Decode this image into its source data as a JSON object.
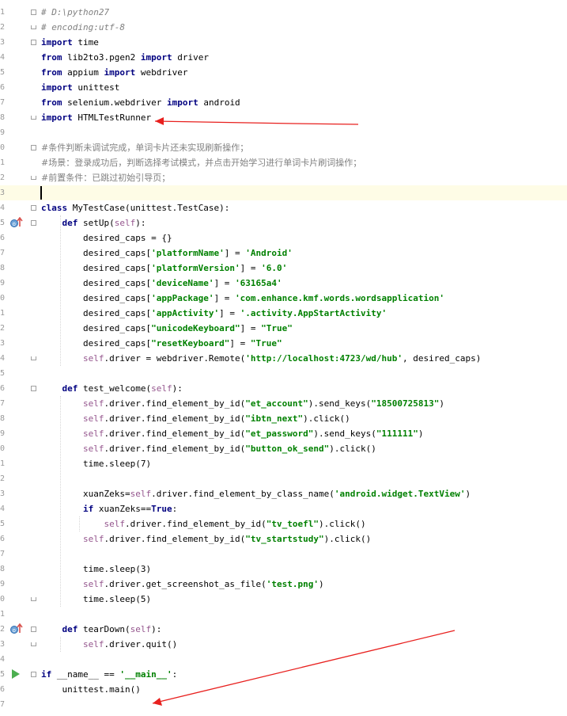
{
  "editor": {
    "line_numbers": [
      "1",
      "2",
      "3",
      "4",
      "5",
      "6",
      "7",
      "8",
      "9",
      "0",
      "1",
      "2",
      "3",
      "4",
      "5",
      "6",
      "7",
      "8",
      "9",
      "0",
      "1",
      "2",
      "3",
      "4",
      "5",
      "6",
      "7",
      "8",
      "9",
      "0",
      "1",
      "2",
      "3",
      "4",
      "5",
      "6",
      "7",
      "8",
      "9",
      "0",
      "1",
      "2",
      "3",
      "4",
      "5",
      "6",
      "7"
    ],
    "current_line": 13,
    "lines": [
      [
        {
          "c": "cmt",
          "t": "# D:\\python27"
        }
      ],
      [
        {
          "c": "cmt",
          "t": "# encoding:utf-8"
        }
      ],
      [
        {
          "c": "kw",
          "t": "import"
        },
        {
          "c": "",
          "t": " time"
        }
      ],
      [
        {
          "c": "kw",
          "t": "from"
        },
        {
          "c": "",
          "t": " lib2to3.pgen2 "
        },
        {
          "c": "kw",
          "t": "import"
        },
        {
          "c": "",
          "t": " driver"
        }
      ],
      [
        {
          "c": "kw",
          "t": "from"
        },
        {
          "c": "",
          "t": " appium "
        },
        {
          "c": "kw",
          "t": "import"
        },
        {
          "c": "",
          "t": " webdriver"
        }
      ],
      [
        {
          "c": "kw",
          "t": "import"
        },
        {
          "c": "",
          "t": " unittest"
        }
      ],
      [
        {
          "c": "kw",
          "t": "from"
        },
        {
          "c": "",
          "t": " selenium.webdriver "
        },
        {
          "c": "kw",
          "t": "import"
        },
        {
          "c": "",
          "t": " android"
        }
      ],
      [
        {
          "c": "kw",
          "t": "import"
        },
        {
          "c": "",
          "t": " HTMLTestRunner"
        }
      ],
      [],
      [
        {
          "c": "zh",
          "t": "#条件判断未调试完成，单词卡片还未实现刷新操作；"
        }
      ],
      [
        {
          "c": "zh",
          "t": "#场景：登录成功后，判断选择考试模式，并点击开始学习进行单词卡片刷词操作；"
        }
      ],
      [
        {
          "c": "zh",
          "t": "#前置条件：已跳过初始引导页；"
        }
      ],
      [],
      [
        {
          "c": "kw",
          "t": "class"
        },
        {
          "c": "",
          "t": " MyTestCase(unittest.TestCase):"
        }
      ],
      [
        {
          "c": "",
          "t": "    "
        },
        {
          "c": "kw",
          "t": "def"
        },
        {
          "c": "",
          "t": " setUp("
        },
        {
          "c": "slf",
          "t": "self"
        },
        {
          "c": "",
          "t": "):"
        }
      ],
      [
        {
          "c": "",
          "t": "        desired_caps = {}"
        }
      ],
      [
        {
          "c": "",
          "t": "        desired_caps["
        },
        {
          "c": "str",
          "t": "'platformName'"
        },
        {
          "c": "",
          "t": "] = "
        },
        {
          "c": "str",
          "t": "'Android'"
        }
      ],
      [
        {
          "c": "",
          "t": "        desired_caps["
        },
        {
          "c": "str",
          "t": "'platformVersion'"
        },
        {
          "c": "",
          "t": "] = "
        },
        {
          "c": "str",
          "t": "'6.0'"
        }
      ],
      [
        {
          "c": "",
          "t": "        desired_caps["
        },
        {
          "c": "str",
          "t": "'deviceName'"
        },
        {
          "c": "",
          "t": "] = "
        },
        {
          "c": "str",
          "t": "'63165a4'"
        }
      ],
      [
        {
          "c": "",
          "t": "        desired_caps["
        },
        {
          "c": "str",
          "t": "'appPackage'"
        },
        {
          "c": "",
          "t": "] = "
        },
        {
          "c": "str",
          "t": "'com.enhance.kmf.words.wordsapplication'"
        }
      ],
      [
        {
          "c": "",
          "t": "        desired_caps["
        },
        {
          "c": "str",
          "t": "'appActivity'"
        },
        {
          "c": "",
          "t": "] = "
        },
        {
          "c": "str",
          "t": "'.activity.AppStartActivity'"
        }
      ],
      [
        {
          "c": "",
          "t": "        desired_caps["
        },
        {
          "c": "str",
          "t": "\"unicodeKeyboard\""
        },
        {
          "c": "",
          "t": "] = "
        },
        {
          "c": "str",
          "t": "\"True\""
        }
      ],
      [
        {
          "c": "",
          "t": "        desired_caps["
        },
        {
          "c": "str",
          "t": "\"resetKeyboard\""
        },
        {
          "c": "",
          "t": "] = "
        },
        {
          "c": "str",
          "t": "\"True\""
        }
      ],
      [
        {
          "c": "",
          "t": "        "
        },
        {
          "c": "slf",
          "t": "self"
        },
        {
          "c": "",
          "t": ".driver = webdriver.Remote("
        },
        {
          "c": "str",
          "t": "'http://localhost:4723/wd/hub'"
        },
        {
          "c": "",
          "t": ", desired_caps)"
        }
      ],
      [],
      [
        {
          "c": "",
          "t": "    "
        },
        {
          "c": "kw",
          "t": "def"
        },
        {
          "c": "",
          "t": " test_welcome("
        },
        {
          "c": "slf",
          "t": "self"
        },
        {
          "c": "",
          "t": "):"
        }
      ],
      [
        {
          "c": "",
          "t": "        "
        },
        {
          "c": "slf",
          "t": "self"
        },
        {
          "c": "",
          "t": ".driver.find_element_by_id("
        },
        {
          "c": "str",
          "t": "\"et_account\""
        },
        {
          "c": "",
          "t": ").send_keys("
        },
        {
          "c": "str",
          "t": "\"18500725813\""
        },
        {
          "c": "",
          "t": ")"
        }
      ],
      [
        {
          "c": "",
          "t": "        "
        },
        {
          "c": "slf",
          "t": "self"
        },
        {
          "c": "",
          "t": ".driver.find_element_by_id("
        },
        {
          "c": "str",
          "t": "\"ibtn_next\""
        },
        {
          "c": "",
          "t": ").click()"
        }
      ],
      [
        {
          "c": "",
          "t": "        "
        },
        {
          "c": "slf",
          "t": "self"
        },
        {
          "c": "",
          "t": ".driver.find_element_by_id("
        },
        {
          "c": "str",
          "t": "\"et_password\""
        },
        {
          "c": "",
          "t": ").send_keys("
        },
        {
          "c": "str",
          "t": "\"111111\""
        },
        {
          "c": "",
          "t": ")"
        }
      ],
      [
        {
          "c": "",
          "t": "        "
        },
        {
          "c": "slf",
          "t": "self"
        },
        {
          "c": "",
          "t": ".driver.find_element_by_id("
        },
        {
          "c": "str",
          "t": "\"button_ok_send\""
        },
        {
          "c": "",
          "t": ").click()"
        }
      ],
      [
        {
          "c": "",
          "t": "        time.sleep(7)"
        }
      ],
      [],
      [
        {
          "c": "",
          "t": "        xuanZeks="
        },
        {
          "c": "slf",
          "t": "self"
        },
        {
          "c": "",
          "t": ".driver.find_element_by_class_name("
        },
        {
          "c": "str",
          "t": "'android.widget.TextView'"
        },
        {
          "c": "",
          "t": ")"
        }
      ],
      [
        {
          "c": "",
          "t": "        "
        },
        {
          "c": "kw",
          "t": "if"
        },
        {
          "c": "",
          "t": " xuanZeks=="
        },
        {
          "c": "kw",
          "t": "True"
        },
        {
          "c": "",
          "t": ":"
        }
      ],
      [
        {
          "c": "",
          "t": "            "
        },
        {
          "c": "slf",
          "t": "self"
        },
        {
          "c": "",
          "t": ".driver.find_element_by_id("
        },
        {
          "c": "str",
          "t": "\"tv_toefl\""
        },
        {
          "c": "",
          "t": ").click()"
        }
      ],
      [
        {
          "c": "",
          "t": "        "
        },
        {
          "c": "slf",
          "t": "self"
        },
        {
          "c": "",
          "t": ".driver.find_element_by_id("
        },
        {
          "c": "str",
          "t": "\"tv_startstudy\""
        },
        {
          "c": "",
          "t": ").click()"
        }
      ],
      [],
      [
        {
          "c": "",
          "t": "        time.sleep(3)"
        }
      ],
      [
        {
          "c": "",
          "t": "        "
        },
        {
          "c": "slf",
          "t": "self"
        },
        {
          "c": "",
          "t": ".driver.get_screenshot_as_file("
        },
        {
          "c": "str",
          "t": "'test.png'"
        },
        {
          "c": "",
          "t": ")"
        }
      ],
      [
        {
          "c": "",
          "t": "        time.sleep(5)"
        }
      ],
      [],
      [
        {
          "c": "",
          "t": "    "
        },
        {
          "c": "kw",
          "t": "def"
        },
        {
          "c": "",
          "t": " tearDown("
        },
        {
          "c": "slf",
          "t": "self"
        },
        {
          "c": "",
          "t": "):"
        }
      ],
      [
        {
          "c": "",
          "t": "        "
        },
        {
          "c": "slf",
          "t": "self"
        },
        {
          "c": "",
          "t": ".driver.quit()"
        }
      ],
      [],
      [
        {
          "c": "kw",
          "t": "if"
        },
        {
          "c": "",
          "t": " __name__ == "
        },
        {
          "c": "str",
          "t": "'__main__'"
        },
        {
          "c": "",
          "t": ":"
        }
      ],
      [
        {
          "c": "",
          "t": "    unittest.main()"
        }
      ],
      []
    ]
  },
  "gutter_icons": [
    {
      "line": 15,
      "icon": "override-method-icon"
    },
    {
      "line": 42,
      "icon": "override-method-icon"
    },
    {
      "line": 45,
      "icon": "run-icon"
    }
  ],
  "annotations": [
    {
      "name": "red-arrow-to-import-htmltestrunner",
      "color": "#e8201e"
    },
    {
      "name": "red-arrow-to-unittest-main",
      "color": "#e8201e"
    }
  ],
  "colors": {
    "keyword": "#000080",
    "string": "#008000",
    "self": "#94558d",
    "comment": "#808080",
    "current_line": "#fefce6",
    "annotation": "#e8201e"
  }
}
